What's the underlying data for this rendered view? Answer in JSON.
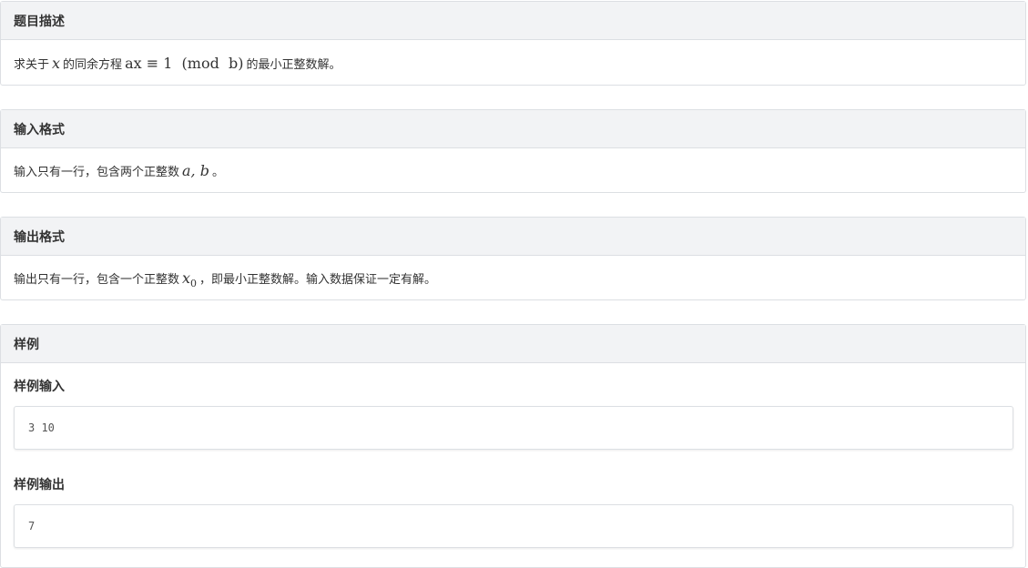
{
  "description": {
    "title": "题目描述",
    "text_before_x": "求关于",
    "var_x": "x",
    "text_mid": "的同余方程",
    "equation": "ax ≡ 1  (mod  b)",
    "text_after": "的最小正整数解。"
  },
  "input_format": {
    "title": "输入格式",
    "text_before": "输入只有一行，包含两个正整数",
    "vars": "a, b",
    "text_after": "。"
  },
  "output_format": {
    "title": "输出格式",
    "text_before": "输出只有一行，包含一个正整数",
    "var": "x",
    "var_sub": "0",
    "text_after": "，即最小正整数解。输入数据保证一定有解。"
  },
  "sample": {
    "title": "样例",
    "input_label": "样例输入",
    "input_value": "3 10",
    "output_label": "样例输出",
    "output_value": "7"
  }
}
